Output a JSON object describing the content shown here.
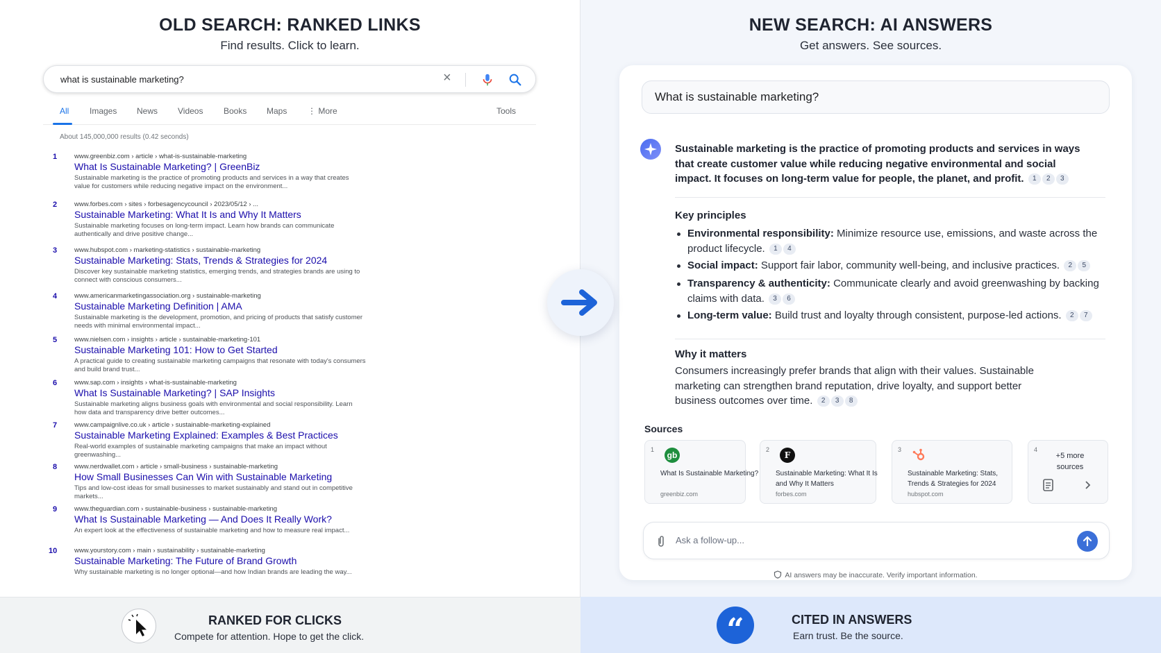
{
  "left": {
    "title": "OLD SEARCH: RANKED LINKS",
    "subtitle": "Find results. Click to learn.",
    "search": {
      "query": "what is sustainable marketing?"
    },
    "tabs": [
      "All",
      "Images",
      "News",
      "Videos",
      "Books",
      "Maps",
      "More",
      "Tools"
    ],
    "stats": "About 145,000,000 results (0.42 seconds)",
    "results": [
      {
        "n": "1",
        "url": "www.greenbiz.com › article › what-is-sustainable-marketing",
        "title": "What Is Sustainable Marketing? | GreenBiz",
        "snippet": "Sustainable marketing is the practice of promoting products and services in a way that creates value for customers while reducing negative impact on the environment..."
      },
      {
        "n": "2",
        "url": "www.forbes.com › sites › forbesagencycouncil › 2023/05/12 › ...",
        "title": "Sustainable Marketing: What It Is and Why It Matters",
        "snippet": "Sustainable marketing focuses on long-term impact. Learn how brands can communicate authentically and drive positive change..."
      },
      {
        "n": "3",
        "url": "www.hubspot.com › marketing-statistics › sustainable-marketing",
        "title": "Sustainable Marketing: Stats, Trends & Strategies for 2024",
        "snippet": "Discover key sustainable marketing statistics, emerging trends, and strategies brands are using to connect with conscious consumers..."
      },
      {
        "n": "4",
        "url": "www.americanmarketingassociation.org › sustainable-marketing",
        "title": "Sustainable Marketing Definition | AMA",
        "snippet": "Sustainable marketing is the development, promotion, and pricing of products that satisfy customer needs with minimal environmental impact..."
      },
      {
        "n": "5",
        "url": "www.nielsen.com › insights › article › sustainable-marketing-101",
        "title": "Sustainable Marketing 101: How to Get Started",
        "snippet": "A practical guide to creating sustainable marketing campaigns that resonate with today's consumers and build brand trust..."
      },
      {
        "n": "6",
        "url": "www.sap.com › insights › what-is-sustainable-marketing",
        "title": "What Is Sustainable Marketing? | SAP Insights",
        "snippet": "Sustainable marketing aligns business goals with environmental and social responsibility. Learn how data and transparency drive better outcomes..."
      },
      {
        "n": "7",
        "url": "www.campaignlive.co.uk › article › sustainable-marketing-explained",
        "title": "Sustainable Marketing Explained: Examples & Best Practices",
        "snippet": "Real-world examples of sustainable marketing campaigns that make an impact without greenwashing..."
      },
      {
        "n": "8",
        "url": "www.nerdwallet.com › article › small-business › sustainable-marketing",
        "title": "How Small Businesses Can Win with Sustainable Marketing",
        "snippet": "Tips and low-cost ideas for small businesses to market sustainably and stand out in competitive markets..."
      },
      {
        "n": "9",
        "url": "www.theguardian.com › sustainable-business › sustainable-marketing",
        "title": "What Is Sustainable Marketing — And Does It Really Work?",
        "snippet": "An expert look at the effectiveness of sustainable marketing and how to measure real impact..."
      },
      {
        "n": "10",
        "url": "www.yourstory.com › main › sustainability › sustainable-marketing",
        "title": "Sustainable Marketing: The Future of Brand Growth",
        "snippet": "Why sustainable marketing is no longer optional—and how Indian brands are leading the way..."
      }
    ]
  },
  "right": {
    "title": "NEW SEARCH: AI ANSWERS",
    "subtitle": "Get answers. See sources.",
    "query": "What is sustainable marketing?",
    "lead": "Sustainable marketing is the practice of promoting products and services in ways that create customer value while reducing negative environmental and social impact. It focuses on long-term value for people, the planet, and profit.",
    "lead_cites": [
      "1",
      "2",
      "3"
    ],
    "key_heading": "Key principles",
    "principles": [
      {
        "term": "Environmental responsibility:",
        "text": "Minimize resource use, emissions, and waste across the product lifecycle.",
        "cites": [
          "1",
          "4"
        ]
      },
      {
        "term": "Social impact:",
        "text": "Support fair labor, community well-being, and inclusive practices.",
        "cites": [
          "2",
          "5"
        ]
      },
      {
        "term": "Transparency & authenticity:",
        "text": "Communicate clearly and avoid greenwashing by backing claims with data.",
        "cites": [
          "3",
          "6"
        ]
      },
      {
        "term": "Long-term value:",
        "text": "Build trust and loyalty through consistent, purpose-led actions.",
        "cites": [
          "2",
          "7"
        ]
      }
    ],
    "why_heading": "Why it matters",
    "why_text": "Consumers increasingly prefer brands that align with their values. Sustainable marketing can strengthen brand reputation, drive loyalty, and support better business outcomes over time.",
    "why_cites": [
      "2",
      "3",
      "8"
    ],
    "sources_heading": "Sources",
    "sources": [
      {
        "n": "1",
        "icon": "gb",
        "title": "What Is Sustainable Marketing?",
        "domain": "greenbiz.com"
      },
      {
        "n": "2",
        "icon": "F",
        "title": "Sustainable Marketing: What It Is and Why It Matters",
        "domain": "forbes.com"
      },
      {
        "n": "3",
        "icon": "hubspot-icon",
        "title": "Sustainable Marketing: Stats, Trends & Strategies for 2024",
        "domain": "hubspot.com"
      }
    ],
    "more": {
      "n": "4",
      "label": "+5 more sources"
    },
    "followup_placeholder": "Ask a follow-up...",
    "disclaimer": "AI answers may be inaccurate. Verify important information."
  },
  "footer": {
    "left_title": "RANKED FOR CLICKS",
    "left_sub": "Compete for attention. Hope to get the click.",
    "right_title": "CITED IN ANSWERS",
    "right_sub": "Earn trust. Be the source."
  },
  "colors": {
    "link": "#1a0dab",
    "accent": "#1a73e8",
    "ai_blue": "#1d63d8"
  }
}
